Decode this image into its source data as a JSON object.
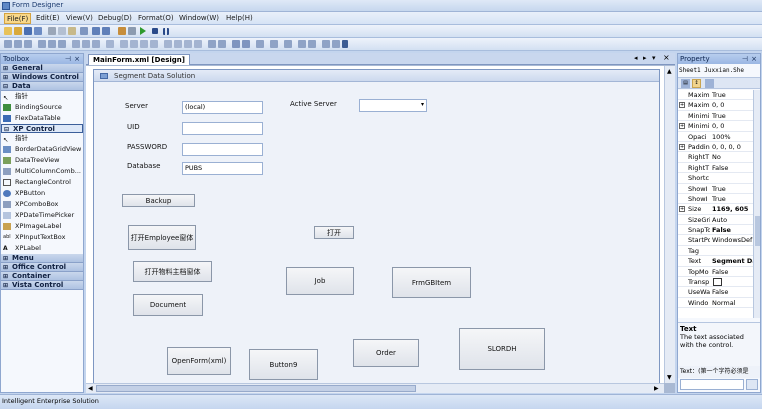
{
  "window": {
    "title": "Form Designer"
  },
  "menu": [
    {
      "label": "File(F)"
    },
    {
      "label": "Edit(E)"
    },
    {
      "label": "View(V)"
    },
    {
      "label": "Debug(D)"
    },
    {
      "label": "Format(O)"
    },
    {
      "label": "Window(W)"
    },
    {
      "label": "Help(H)"
    }
  ],
  "toolbox": {
    "title": "Toolbox",
    "groups": [
      {
        "label": "General"
      },
      {
        "label": "Windows Control"
      },
      {
        "label": "Data",
        "items": [
          "指针",
          "BindingSource",
          "FlexDataTable"
        ]
      },
      {
        "label": "XP Control",
        "items": [
          "指针",
          "BorderDataGridView",
          "DataTreeView",
          "MultiColumnComb...",
          "RectangleControl",
          "XPButton",
          "XPComboBox",
          "XPDateTimePicker",
          "XPImageLabel",
          "XPInputTextBox",
          "XPLabel"
        ]
      },
      {
        "label": "Menu"
      },
      {
        "label": "Office Control"
      },
      {
        "label": "Container"
      },
      {
        "label": "Vista Control"
      }
    ]
  },
  "designer": {
    "tab": "MainForm.xml [Design]",
    "form_title": "Segment Data Solution",
    "labels": {
      "server": "Server",
      "active_server": "Active Server",
      "uid": "UID",
      "password": "PASSWORD",
      "database": "Database"
    },
    "inputs": {
      "server": "(local)",
      "uid": "",
      "password": "",
      "database": "PUBS",
      "active_server": ""
    },
    "buttons": {
      "backup": "Backup",
      "open_employee": "打开Employee窗体",
      "open": "打开",
      "open_material": "打开物料主档窗体",
      "job": "Job",
      "frmgbitem": "FrmGBItem",
      "document": "Document",
      "openform": "OpenForm(xml)",
      "button9": "Button9",
      "order": "Order",
      "slordh": "SLORDH"
    }
  },
  "property": {
    "title": "Property",
    "object": "Sheet1 Juxxian.She",
    "rows": [
      {
        "name": "Maxim",
        "value": "True",
        "expand": false
      },
      {
        "name": "Maxim",
        "value": "0, 0",
        "expand": true
      },
      {
        "name": "Minimi",
        "value": "True",
        "expand": false
      },
      {
        "name": "Minimi",
        "value": "0, 0",
        "expand": true
      },
      {
        "name": "Opaci",
        "value": "100%",
        "expand": false
      },
      {
        "name": "Paddin",
        "value": "0, 0, 0, 0",
        "expand": true
      },
      {
        "name": "RightT",
        "value": "No",
        "expand": false
      },
      {
        "name": "RightT",
        "value": "False",
        "expand": false
      },
      {
        "name": "Shortc",
        "value": "",
        "expand": false
      },
      {
        "name": "ShowI",
        "value": "True",
        "expand": false
      },
      {
        "name": "ShowI",
        "value": "True",
        "expand": false
      },
      {
        "name": "Size",
        "value": "1169, 605",
        "expand": true,
        "bold": true
      },
      {
        "name": "SizeGri",
        "value": "Auto",
        "expand": false
      },
      {
        "name": "SnapTo",
        "value": "False",
        "expand": false,
        "bold": true
      },
      {
        "name": "StartPo",
        "value": "WindowsDef",
        "expand": false
      },
      {
        "name": "Tag",
        "value": "",
        "expand": false
      },
      {
        "name": "Text",
        "value": "Segment Da",
        "expand": false,
        "bold": true
      },
      {
        "name": "TopMo",
        "value": "False",
        "expand": false
      },
      {
        "name": "Transp",
        "value": "",
        "expand": false,
        "swatch": true
      },
      {
        "name": "UseWa",
        "value": "False",
        "expand": false
      },
      {
        "name": "Windo",
        "value": "Normal",
        "expand": false
      }
    ],
    "desc_title": "Text",
    "desc_body": "The text associated with the control.",
    "bottom_text": "Text：(第一个字符必须是"
  },
  "status": {
    "text": "Intelligent Enterprise Solution"
  },
  "colors": {
    "menu_active": "#f9d889",
    "accent": "#3c5f9a"
  }
}
